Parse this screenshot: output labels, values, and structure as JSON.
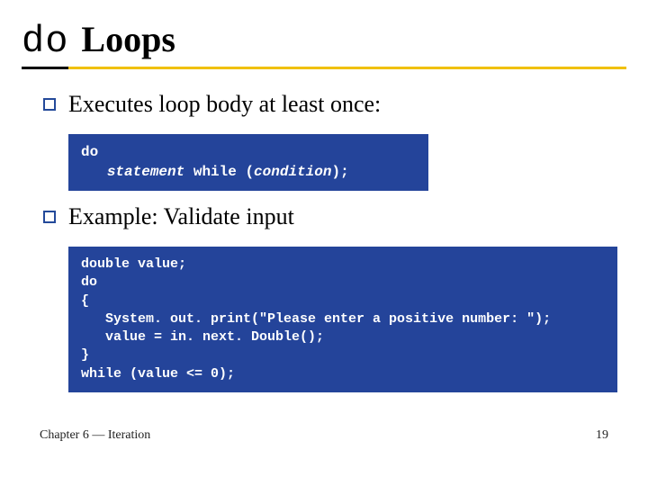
{
  "title": {
    "do": "do",
    "loops": "Loops"
  },
  "bullets": {
    "b1": "Executes loop body at least once:",
    "b2": "Example: Validate input"
  },
  "code1": {
    "l1": "do",
    "l2_indent": "   ",
    "l2_stmt": "statement",
    "l2_mid": " while (",
    "l2_cond": "condition",
    "l2_end": ");"
  },
  "code2": {
    "l1": "double value;",
    "l2": "do",
    "l3": "{",
    "l4": "   System. out. print(\"Please enter a positive number: \");",
    "l5": "   value = in. next. Double();",
    "l6": "}",
    "l7": "while (value <= 0);"
  },
  "footer": {
    "left": "Chapter 6 — Iteration",
    "right": "19"
  }
}
